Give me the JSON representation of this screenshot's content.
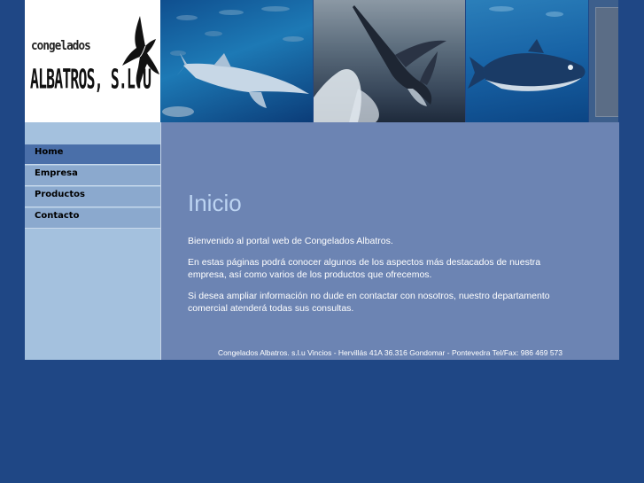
{
  "header": {
    "logo_top": "congelados",
    "logo_main": "ALBATROS, S.L.U"
  },
  "nav": {
    "items": [
      {
        "label": "Home"
      },
      {
        "label": "Empresa"
      },
      {
        "label": "Productos"
      },
      {
        "label": "Contacto"
      }
    ],
    "active": "Home"
  },
  "main": {
    "title": "Inicio",
    "paragraphs": [
      "Bienvenido al portal web de Congelados Albatros.",
      "En estas páginas podrá conocer algunos de los aspectos más destacados de nuestra empresa, así como varios de los productos que ofrecemos.",
      "Si desea ampliar información no dude en contactar con nosotros, nuestro departamento comercial atenderá todas sus consultas."
    ]
  },
  "footer": {
    "text": "Congelados Albatros. s.l.u Vincios - Hervillás 41A 36.316 Gondomar - Pontevedra Tel/Fax: 986 469 573"
  },
  "colors": {
    "page_background": "#1f4785",
    "sidebar": "#a4c1de",
    "nav_active": "#4a6fa9",
    "nav_item": "#8ba9ce",
    "content": "#6c84b3",
    "title": "#bcd4f2"
  },
  "icons": [
    "albatross-bird-icon"
  ]
}
